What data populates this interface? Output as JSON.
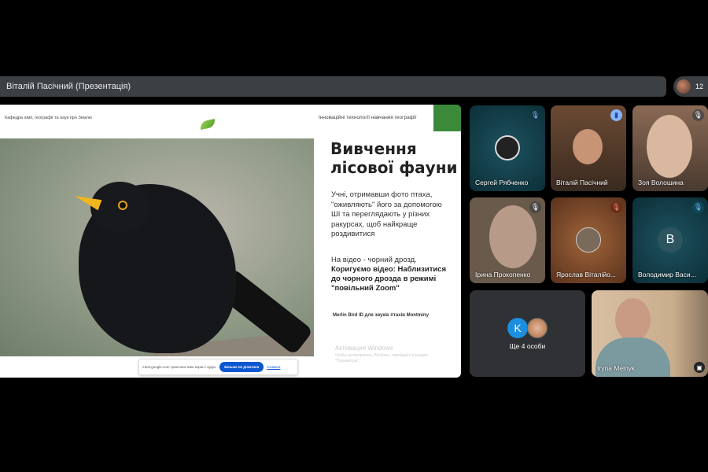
{
  "topbar": {
    "presenter": "Віталій Пасічний (Презентація)",
    "participant_count": "12"
  },
  "slide": {
    "header_left": "Кафедра хімії, географії та наук про Землю",
    "header_right": "Інноваційні технології навчання географії",
    "title_line1": "Вивчення",
    "title_line2": "лісової фауни",
    "paragraph": "Учні, отримавши фото птаха, \"оживляють\" його за допомогою ШІ та переглядають у різних ракурсах, щоб найкраще роздивитися",
    "video_note": "На відео - чорний дрозд.",
    "bold_text": "Коригуємо відео: Наблизитися до чорного дрозда в режимі \"повільний Zoom\"",
    "merlin": "Merlin Bird ID для звуків птахів Montminy",
    "windows_title": "Активация Windows",
    "windows_sub": "Чтобы активировать Windows, перейдите в раздел \"Параметры\"."
  },
  "share_bar": {
    "message": "meet.google.com транслює ваш екран і аудіо.",
    "stop_button": "Більше не ділитися",
    "hide_button": "Сховати"
  },
  "participants": [
    {
      "name": "Сергей Рябченко",
      "mic": "muted"
    },
    {
      "name": "Віталій Пасічний",
      "mic": "speaking"
    },
    {
      "name": "Зоя Волошина",
      "mic": "muted"
    },
    {
      "name": "Ірина Прокопенко",
      "mic": "muted"
    },
    {
      "name": "Ярослав Віталійо...",
      "mic": "muted"
    },
    {
      "name": "Володимир Васи...",
      "mic": "muted",
      "initial": "В"
    },
    {
      "name": "Iryna Melnyk"
    }
  ],
  "more": {
    "label": "Ще 4 особи",
    "initial": "K"
  }
}
